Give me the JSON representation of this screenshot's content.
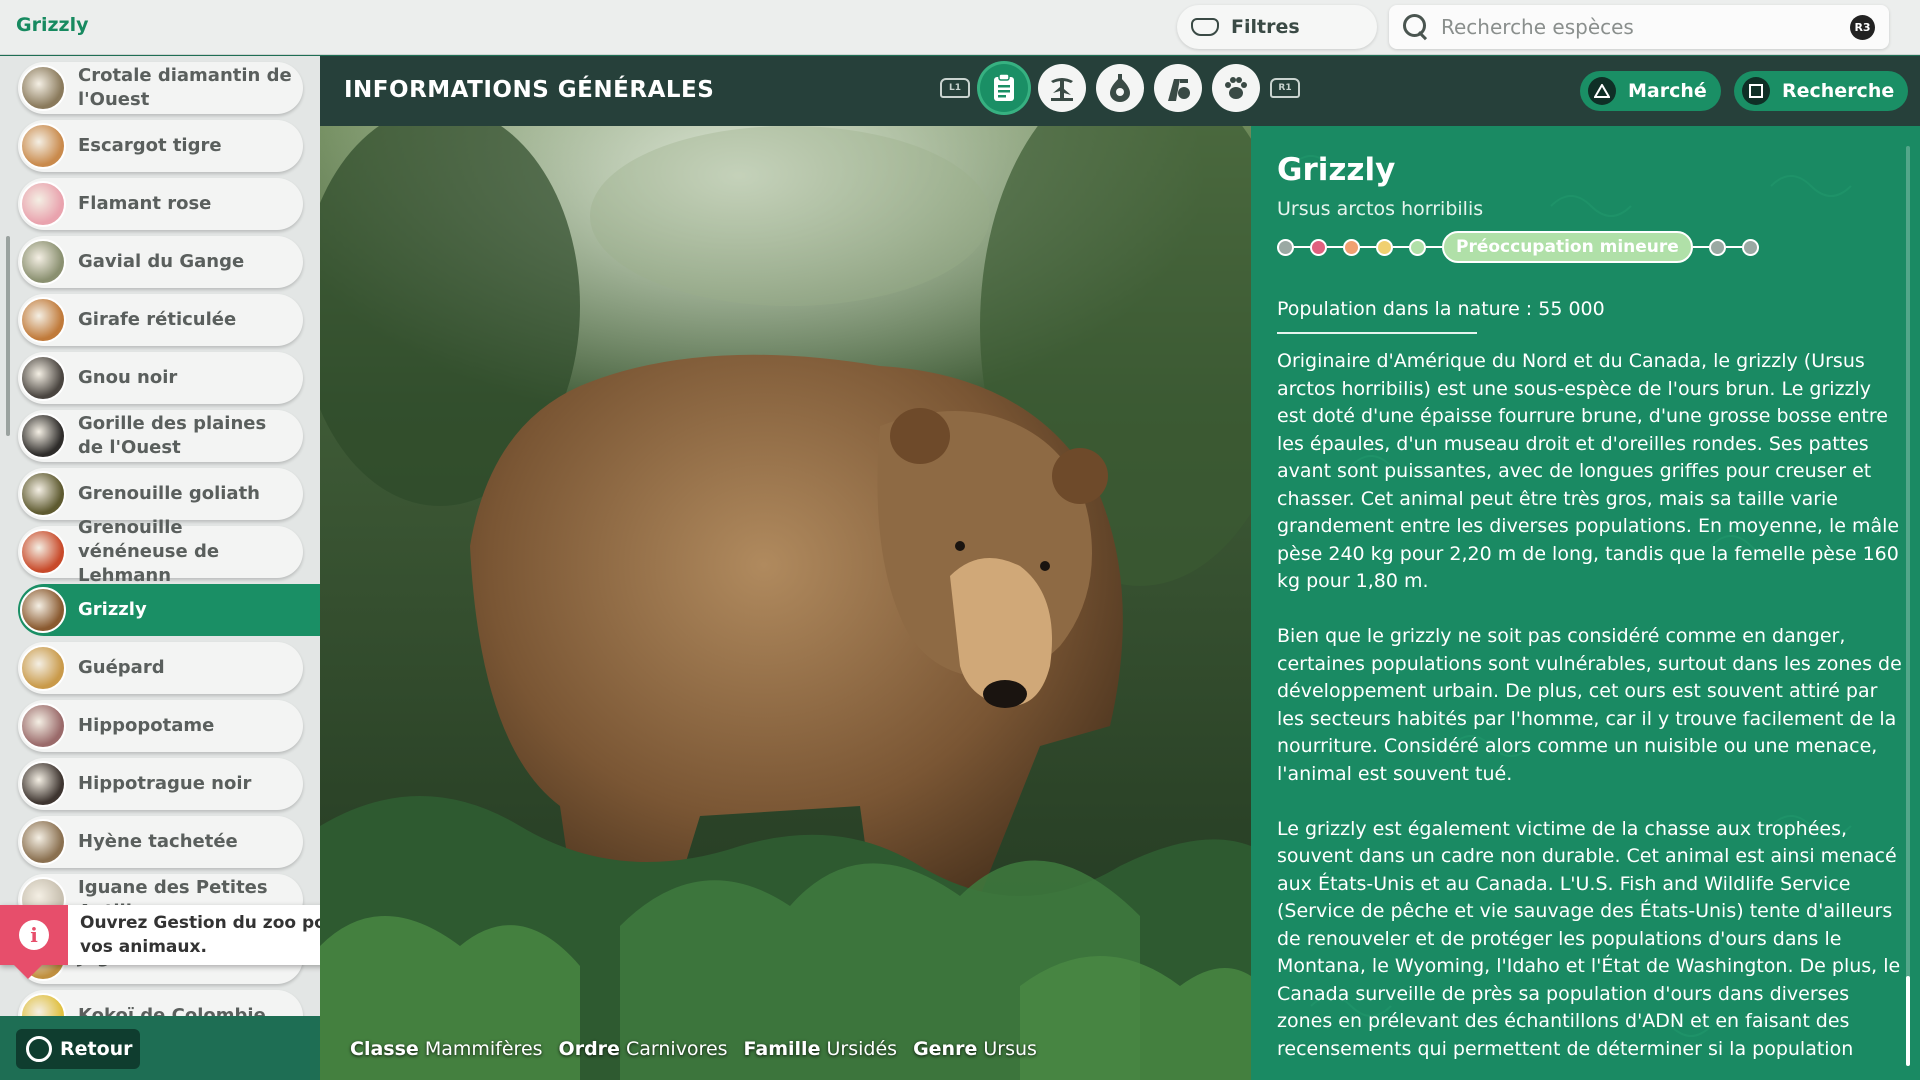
{
  "topbar": {
    "breadcrumb": "Grizzly",
    "filters_label": "Filtres",
    "search_placeholder": "Recherche espèces",
    "search_shortcut": "R3"
  },
  "species_list": [
    {
      "name": "Crotale diamantin de l'Ouest",
      "color": "#8a7a5c"
    },
    {
      "name": "Escargot tigre",
      "color": "#c98a4c"
    },
    {
      "name": "Flamant rose",
      "color": "#e9a3ae"
    },
    {
      "name": "Gavial du Gange",
      "color": "#8a9070"
    },
    {
      "name": "Girafe réticulée",
      "color": "#c07a3a"
    },
    {
      "name": "Gnou noir",
      "color": "#4a4540"
    },
    {
      "name": "Gorille des plaines de l'Ouest",
      "color": "#2e2c2a"
    },
    {
      "name": "Grenouille goliath",
      "color": "#5e5a30"
    },
    {
      "name": "Grenouille vénéneuse de Lehmann",
      "color": "#c84a2a"
    },
    {
      "name": "Grizzly",
      "color": "#8a5a30",
      "active": true
    },
    {
      "name": "Guépard",
      "color": "#c99a4a"
    },
    {
      "name": "Hippopotame",
      "color": "#9a6a6a"
    },
    {
      "name": "Hippotrague noir",
      "color": "#3e3530"
    },
    {
      "name": "Hyène tachetée",
      "color": "#8a7050"
    },
    {
      "name": "Iguane des Petites Antilles",
      "color": "#c8c0b0"
    },
    {
      "name": "Jaguar",
      "color": "#c09040"
    },
    {
      "name": "Kokoï de Colombie",
      "color": "#e0c040"
    }
  ],
  "tooltip": {
    "text": "Ouvrez Gestion du zoo pour voir la liste de tous vos animaux."
  },
  "back_label": "Retour",
  "header": {
    "title": "INFORMATIONS GÉNÉRALES",
    "bumper_left": "L1",
    "bumper_right": "R1",
    "market_label": "Marché",
    "research_label": "Recherche"
  },
  "taxonomy": {
    "class_label": "Classe",
    "class_value": "Mammifères",
    "order_label": "Ordre",
    "order_value": "Carnivores",
    "family_label": "Famille",
    "family_value": "Ursidés",
    "genus_label": "Genre",
    "genus_value": "Ursus"
  },
  "info": {
    "name": "Grizzly",
    "latin": "Ursus arctos horribilis",
    "status_label": "Préoccupation mineure",
    "status_colors": [
      "#9aa9a3",
      "#e0607e",
      "#f0a070",
      "#f0d070",
      "#b0e0a8",
      "#9aa9a3",
      "#9aa9a3"
    ],
    "population": "Population dans la nature : 55 000",
    "paragraphs": [
      "Originaire d'Amérique du Nord et du Canada, le grizzly (Ursus arctos horribilis) est une sous-espèce de l'ours brun. Le grizzly est doté d'une épaisse fourrure brune, d'une grosse bosse entre les épaules, d'un museau droit et d'oreilles rondes. Ses pattes avant sont puissantes, avec de longues griffes pour creuser et chasser. Cet animal peut être très gros, mais sa taille varie grandement entre les diverses populations. En moyenne, le mâle pèse 240 kg pour 2,20 m de long, tandis que la femelle pèse 160 kg pour 1,80 m.",
      "Bien que le grizzly ne soit pas considéré comme en danger, certaines populations sont vulnérables, surtout dans les zones de développement urbain. De plus, cet ours est souvent attiré par les secteurs habités par l'homme, car il y trouve facilement de la nourriture. Considéré alors comme un nuisible ou une menace, l'animal est souvent tué.",
      "Le grizzly est également victime de la chasse aux trophées, souvent dans un cadre non durable. Cet animal est ainsi menacé aux États-Unis et au Canada. L'U.S. Fish and Wildlife Service (Service de pêche et vie sauvage des États-Unis) tente d'ailleurs de renouveler et de protéger les populations d'ours dans le Montana, le Wyoming, l'Idaho et l'État de Washington. De plus, le Canada surveille de près sa population d'ours dans diverses zones en prélevant des échantillons d'ADN et en faisant des recensements qui permettent de déterminer si la population"
    ]
  },
  "colors": {
    "accent": "#1a8f65",
    "header_bg": "#26403a",
    "tooltip_badge": "#e74e6b"
  }
}
